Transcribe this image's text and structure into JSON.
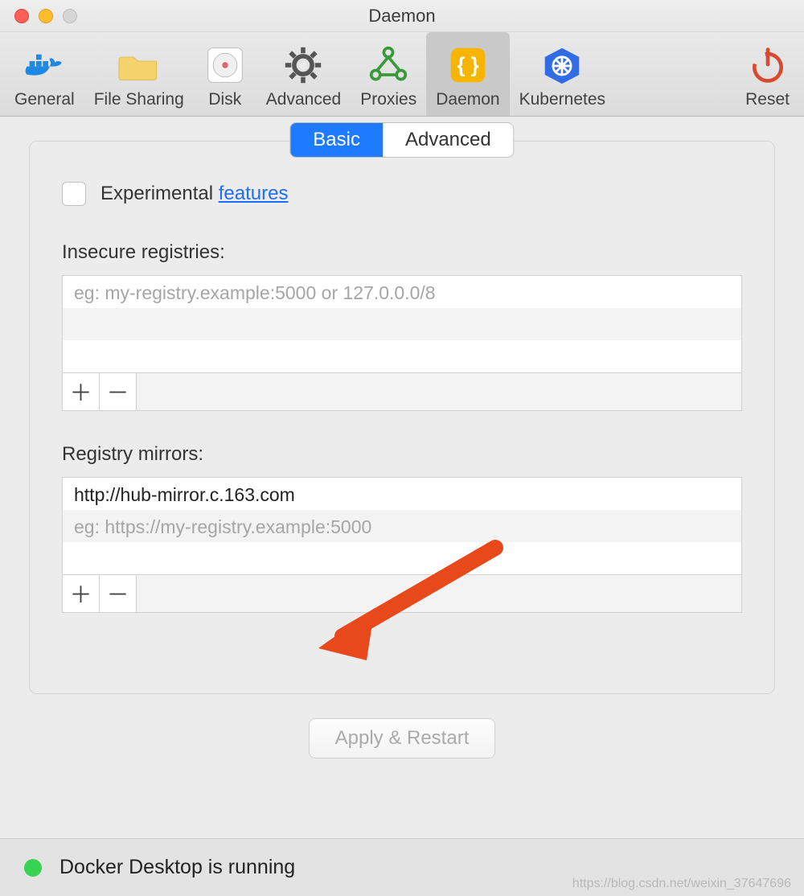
{
  "window": {
    "title": "Daemon"
  },
  "toolbar": {
    "items": [
      {
        "id": "general",
        "label": "General"
      },
      {
        "id": "filesharing",
        "label": "File Sharing"
      },
      {
        "id": "disk",
        "label": "Disk"
      },
      {
        "id": "advanced",
        "label": "Advanced"
      },
      {
        "id": "proxies",
        "label": "Proxies"
      },
      {
        "id": "daemon",
        "label": "Daemon"
      },
      {
        "id": "kubernetes",
        "label": "Kubernetes"
      }
    ],
    "reset_label": "Reset"
  },
  "segments": {
    "basic": "Basic",
    "advanced": "Advanced",
    "active": "basic"
  },
  "experimental": {
    "label_prefix": "Experimental ",
    "link_text": "features",
    "checked": false
  },
  "insecure": {
    "section_label": "Insecure registries:",
    "placeholder": "eg: my-registry.example:5000 or 127.0.0.0/8",
    "values": []
  },
  "mirrors": {
    "section_label": "Registry mirrors:",
    "placeholder": "eg: https://my-registry.example:5000",
    "values": [
      "http://hub-mirror.c.163.com"
    ]
  },
  "apply_label": "Apply & Restart",
  "status": {
    "text": "Docker Desktop is running",
    "color": "#39d353"
  },
  "watermark": "https://blog.csdn.net/weixin_37647696"
}
